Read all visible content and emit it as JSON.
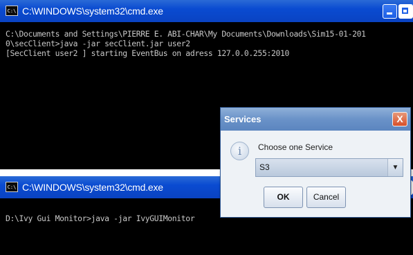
{
  "window_top": {
    "icon_text": "C:\\",
    "title": "C:\\WINDOWS\\system32\\cmd.exe",
    "console_lines": [
      "C:\\Documents and Settings\\PIERRE E. ABI-CHAR\\My Documents\\Downloads\\Sim15-01-201",
      "0\\secClient>java -jar secClient.jar user2",
      "[SecClient user2 ] starting EventBus on adress 127.0.0.255:2010"
    ]
  },
  "window_bottom": {
    "icon_text": "C:\\",
    "title": "C:\\WINDOWS\\system32\\cmd.exe",
    "console_lines": [
      "D:\\Ivy Gui Monitor>java -jar IvyGUIMonitor"
    ]
  },
  "dialog": {
    "title": "Services",
    "close_glyph": "X",
    "info_glyph": "i",
    "message": "Choose one Service",
    "selected_service": "S3",
    "dropdown_glyph": "▼",
    "ok_label": "OK",
    "cancel_label": "Cancel"
  },
  "colors": {
    "titlebar": "#0a4bd1",
    "console_bg": "#000000",
    "console_text": "#c8c8c8",
    "dialog_title": "#6a92c8",
    "close_button": "#d7502a"
  },
  "icons": {
    "window_icon": "command-prompt-icon",
    "dialog_info": "info-icon",
    "dialog_close": "close-icon"
  }
}
